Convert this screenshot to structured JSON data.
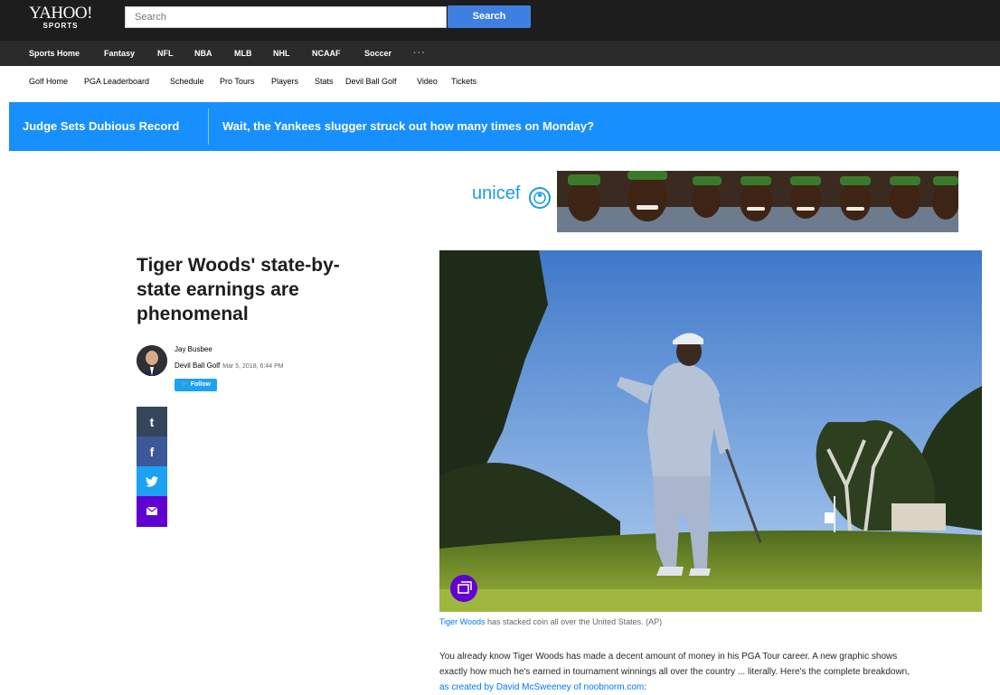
{
  "header": {
    "logo_main": "YAHOO!",
    "logo_sub": "SPORTS",
    "search_placeholder": "Search",
    "search_button": "Search"
  },
  "nav_primary": [
    "Sports Home",
    "Fantasy",
    "NFL",
    "NBA",
    "MLB",
    "NHL",
    "NCAAF",
    "Soccer",
    "···"
  ],
  "nav_secondary": [
    "Golf Home",
    "PGA Leaderboard",
    "Schedule",
    "Pro Tours",
    "Players",
    "Stats",
    "Devil Ball Golf",
    "Video",
    "Tickets"
  ],
  "banner": {
    "headline": "Judge Sets Dubious Record",
    "teaser": "Wait, the Yankees slugger struck out how many times on Monday?"
  },
  "ad": {
    "brand": "unicef"
  },
  "article": {
    "title": "Tiger Woods' state-by-state earnings are phenomenal",
    "author": "Jay Busbee",
    "outlet": "Devil Ball Golf",
    "date": "Mar 5, 2018, 6:44 PM",
    "follow_label": "Follow",
    "caption_link": "Tiger Woods",
    "caption_text": " has stacked coin all over the United States. (AP)",
    "body_line1": "You already know Tiger Woods has made a decent amount of money in his PGA Tour career. A new graphic shows",
    "body_line2": "exactly how much he's earned in tournament winnings all over the country ... literally. Here's the complete breakdown,",
    "body_link": "as created by David McSweeney of noobnorm.com",
    "body_tail": ":"
  },
  "share": [
    {
      "name": "tumblr",
      "glyph": "t",
      "color": "#35465c"
    },
    {
      "name": "facebook",
      "glyph": "f",
      "color": "#3b5998"
    },
    {
      "name": "twitter",
      "glyph": "🐦",
      "color": "#1da1f2"
    },
    {
      "name": "email",
      "glyph": "✉",
      "color": "#6001d2"
    }
  ]
}
